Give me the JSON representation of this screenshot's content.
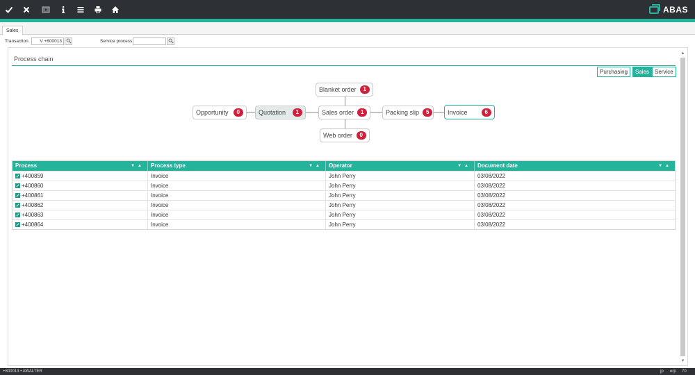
{
  "toolbar": {
    "buttons": [
      {
        "name": "confirm-icon",
        "glyph": "✔"
      },
      {
        "name": "cancel-icon",
        "glyph": "✕"
      },
      {
        "name": "screen-icon",
        "glyph": "▣"
      },
      {
        "name": "info-icon",
        "glyph": "ℹ"
      },
      {
        "name": "menu-icon",
        "glyph": "≡"
      },
      {
        "name": "print-icon",
        "glyph": "⎙"
      },
      {
        "name": "home-icon",
        "glyph": "⌂"
      }
    ],
    "logo_text": "ABAS",
    "accent_color": "#26b39c",
    "bar_color": "#2d3136"
  },
  "tabs": [
    {
      "label": "Sales"
    }
  ],
  "header": {
    "transaction_label": "Transaction",
    "transaction_value": "V +800013",
    "service_process_label": "Service process",
    "service_process_value": ""
  },
  "panel": {
    "title": "Process chain",
    "segments": [
      {
        "label": "Purchasing",
        "active": false
      },
      {
        "label": "Sales",
        "active": true
      },
      {
        "label": "Service",
        "active": false
      }
    ]
  },
  "process_chain": {
    "nodes": {
      "blanket_order": {
        "label": "Blanket order",
        "count": "1"
      },
      "opportunity": {
        "label": "Opportunity",
        "count": "0"
      },
      "quotation": {
        "label": "Quotation",
        "count": "1"
      },
      "sales_order": {
        "label": "Sales order",
        "count": "1"
      },
      "packing_slip": {
        "label": "Packing slip",
        "count": "5"
      },
      "invoice": {
        "label": "Invoice",
        "count": "6"
      },
      "web_order": {
        "label": "Web order",
        "count": "0"
      }
    },
    "badge_color": "#d1203b"
  },
  "table": {
    "columns": [
      "Process",
      "Process type",
      "Operator",
      "Document date"
    ],
    "rows": [
      [
        "+400859",
        "Invoice",
        "John Perry",
        "03/08/2022"
      ],
      [
        "+400860",
        "Invoice",
        "John Perry",
        "03/08/2022"
      ],
      [
        "+400861",
        "Invoice",
        "John Perry",
        "03/08/2022"
      ],
      [
        "+400862",
        "Invoice",
        "John Perry",
        "03/08/2022"
      ],
      [
        "+400863",
        "Invoice",
        "John Perry",
        "03/08/2022"
      ],
      [
        "+400864",
        "Invoice",
        "John Perry",
        "03/08/2022"
      ]
    ]
  },
  "statusbar": {
    "left": "+800013 • AWALTER",
    "items": [
      "jp",
      "erp",
      "70"
    ]
  }
}
